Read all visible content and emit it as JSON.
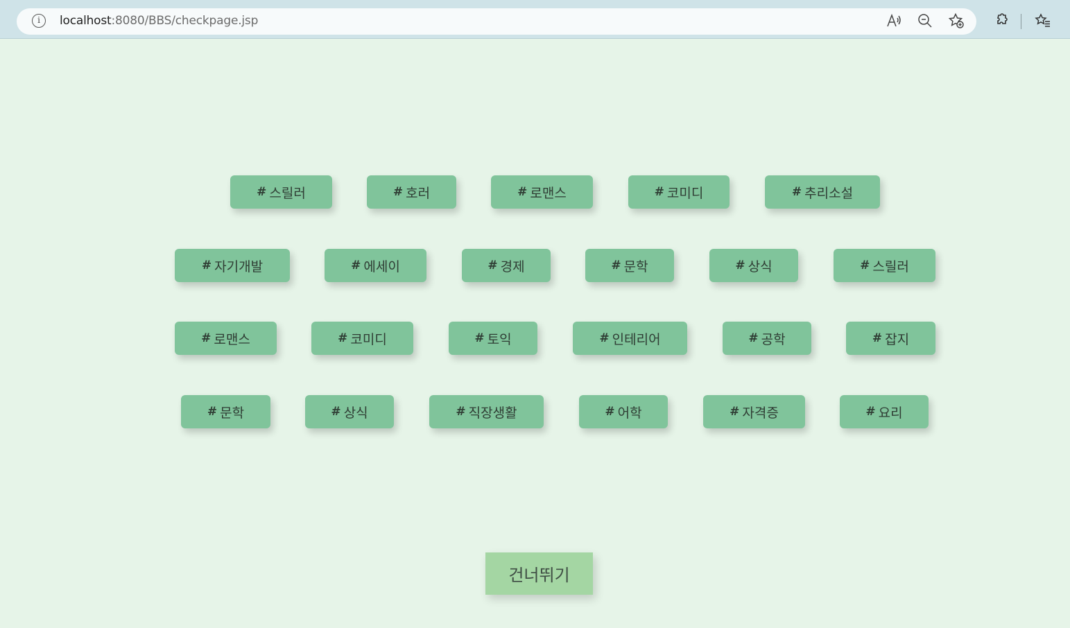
{
  "browser": {
    "url_host": "localhost",
    "url_path": ":8080/BBS/checkpage.jsp",
    "icons": [
      "info-icon",
      "read-aloud-icon",
      "zoom-out-icon",
      "add-favorite-icon",
      "extensions-icon",
      "favorites-icon"
    ]
  },
  "tags": {
    "hash": "#",
    "row1": [
      "스릴러",
      "호러",
      "로맨스",
      "코미디",
      "추리소설"
    ],
    "row2": [
      "자기개발",
      "에세이",
      "경제",
      "문학",
      "상식",
      "스릴러"
    ],
    "row3": [
      "로맨스",
      "코미디",
      "토익",
      "인테리어",
      "공학",
      "잡지"
    ],
    "row4": [
      "문학",
      "상식",
      "직장생활",
      "어학",
      "자격증",
      "요리"
    ]
  },
  "skip_button": {
    "label": "건너뛰기"
  },
  "colors": {
    "page_background": "#e6f4e8",
    "tag_background": "#80c49b",
    "skip_background": "#a4d6a3",
    "browser_bar": "#cfe3e8"
  }
}
